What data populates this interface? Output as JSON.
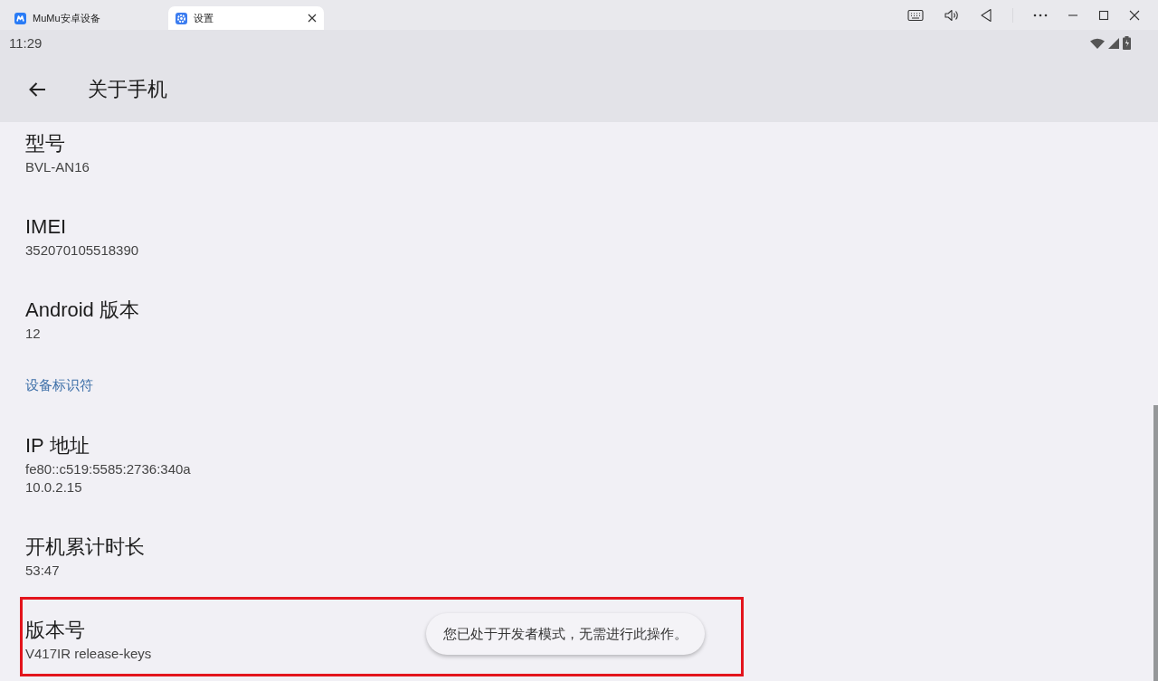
{
  "window": {
    "tabs": [
      {
        "label": "MuMu安卓设备",
        "selected": false
      },
      {
        "label": "设置",
        "selected": true
      }
    ]
  },
  "status_bar": {
    "time": "11:29"
  },
  "app_bar": {
    "title": "关于手机"
  },
  "items": [
    {
      "kind": "item",
      "title": "型号",
      "values": [
        "BVL-AN16"
      ],
      "highlighted": false
    },
    {
      "kind": "item",
      "title": "IMEI",
      "values": [
        "352070105518390"
      ],
      "highlighted": false
    },
    {
      "kind": "item",
      "title": "Android 版本",
      "values": [
        "12"
      ],
      "highlighted": false
    },
    {
      "kind": "header",
      "title": "设备标识符"
    },
    {
      "kind": "item",
      "title": "IP 地址",
      "values": [
        "fe80::c519:5585:2736:340a",
        "10.0.2.15"
      ],
      "highlighted": false
    },
    {
      "kind": "item",
      "title": "开机累计时长",
      "values": [
        "53:47"
      ],
      "highlighted": false
    },
    {
      "kind": "item",
      "title": "版本号",
      "values": [
        "V417IR release-keys"
      ],
      "highlighted": true
    }
  ],
  "toast": {
    "text": "您已处于开发者模式，无需进行此操作。"
  }
}
